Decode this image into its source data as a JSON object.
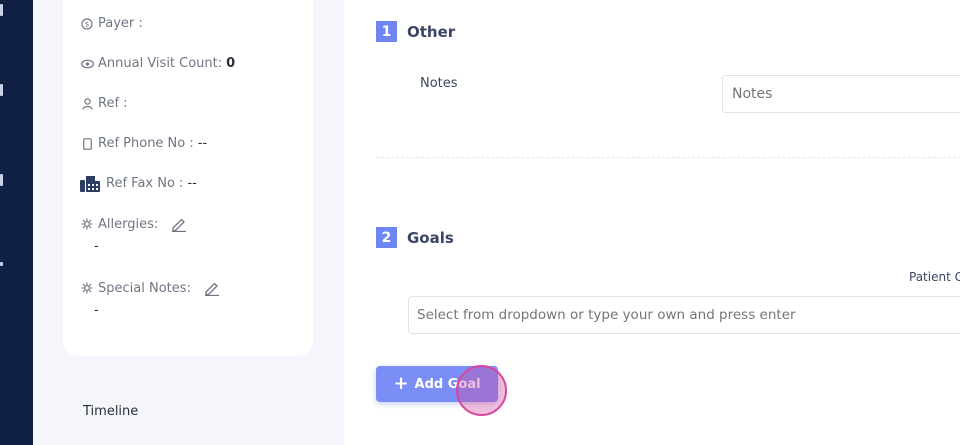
{
  "patient_card": {
    "payer_label": "Payer :",
    "annual_visit_label": "Annual Visit Count:",
    "annual_visit_value": "0",
    "ref_label": "Ref :",
    "ref_phone_label": "Ref Phone No :",
    "ref_phone_value": "--",
    "ref_fax_label": "Ref Fax No :",
    "ref_fax_value": "--",
    "allergies_label": "Allergies:",
    "allergies_value": "-",
    "special_notes_label": "Special Notes:",
    "special_notes_value": "-"
  },
  "timeline_label": "Timeline",
  "sections": {
    "other": {
      "number": "1",
      "title": "Other",
      "notes_label": "Notes",
      "notes_placeholder": "Notes"
    },
    "goals": {
      "number": "2",
      "title": "Goals",
      "patient_label": "Patient G",
      "goals_placeholder": "Select from dropdown or type your own and press enter",
      "add_goal_label": "Add Goal",
      "add_goal_icon": "plus-icon"
    }
  },
  "colors": {
    "rail": "#0f2044",
    "accent": "#6f86f2",
    "button": "#7b8ef5",
    "cursor_ring": "#d6479c"
  }
}
